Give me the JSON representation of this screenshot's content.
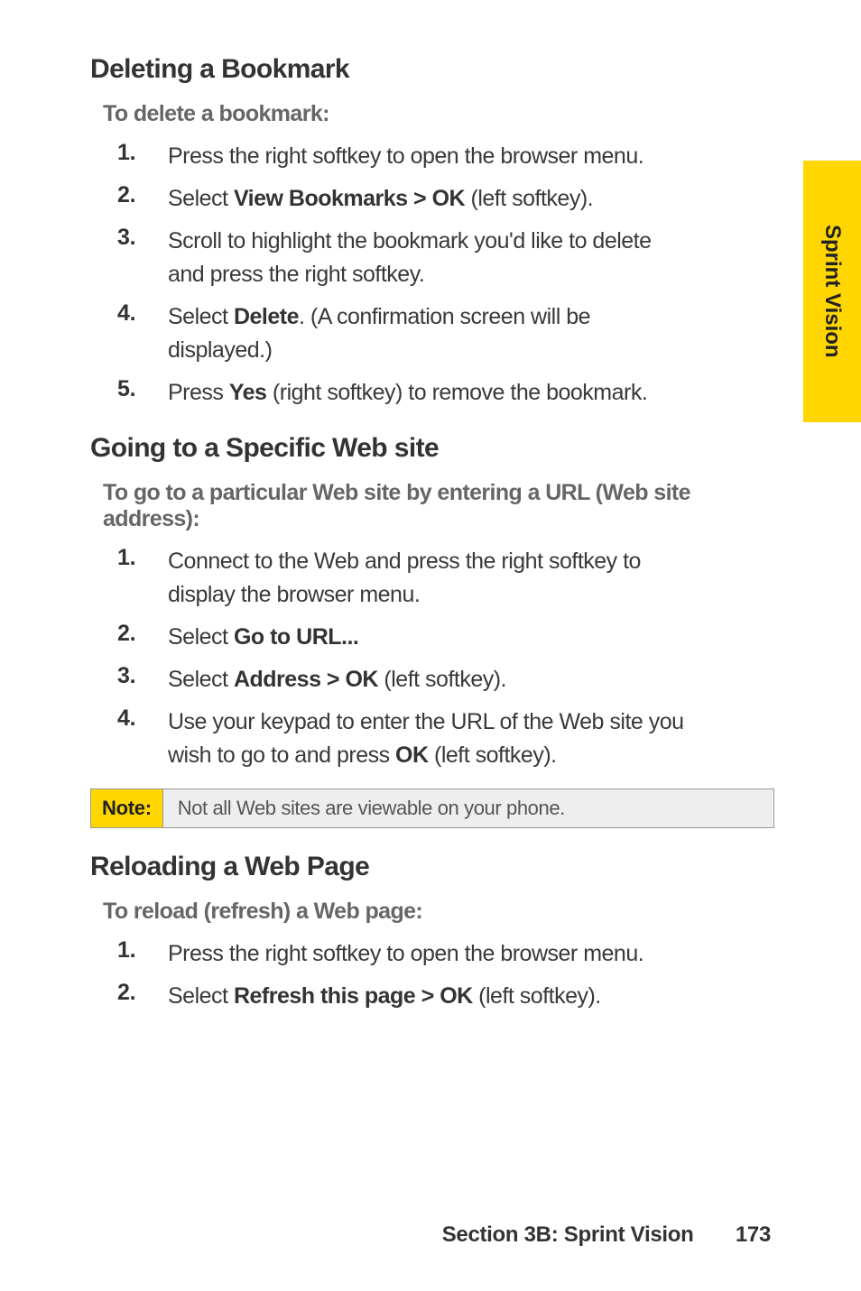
{
  "sideTab": "Sprint Vision",
  "sections": {
    "delBookmark": {
      "heading": "Deleting a Bookmark",
      "intro": "To delete a bookmark:",
      "items": [
        {
          "num": "1.",
          "html": "Press the right softkey to open the browser menu."
        },
        {
          "num": "2.",
          "html": "Select <b>View Bookmarks > OK</b> (left softkey)."
        },
        {
          "num": "3.",
          "html": "Scroll to highlight the bookmark you'd like to delete and press the right softkey."
        },
        {
          "num": "4.",
          "html": "Select <b>Delete</b>. (A confirmation screen will be displayed.)"
        },
        {
          "num": "5.",
          "html": "Press <b>Yes</b> (right softkey) to remove the bookmark."
        }
      ]
    },
    "gotoSite": {
      "heading": "Going to a Specific Web site",
      "intro": "To go to a particular Web site by entering a URL (Web site address):",
      "items": [
        {
          "num": "1.",
          "html": "Connect to the Web and press the right softkey to display the browser menu."
        },
        {
          "num": "2.",
          "html": "Select <b>Go to URL...</b>"
        },
        {
          "num": "3.",
          "html": "Select <b>Address > OK</b> (left softkey)."
        },
        {
          "num": "4.",
          "html": "Use your keypad to enter the URL of the Web site you wish to go to and press <b>OK</b> (left softkey)."
        }
      ]
    },
    "reload": {
      "heading": "Reloading a Web Page",
      "intro": "To reload (refresh) a Web page:",
      "items": [
        {
          "num": "1.",
          "html": "Press the right softkey to open the browser menu."
        },
        {
          "num": "2.",
          "html": "Select <b>Refresh this page > OK</b> (left softkey)."
        }
      ]
    }
  },
  "note": {
    "label": "Note:",
    "text": "Not all Web sites are viewable on your phone."
  },
  "footer": {
    "section": "Section 3B: Sprint Vision",
    "page": "173"
  }
}
